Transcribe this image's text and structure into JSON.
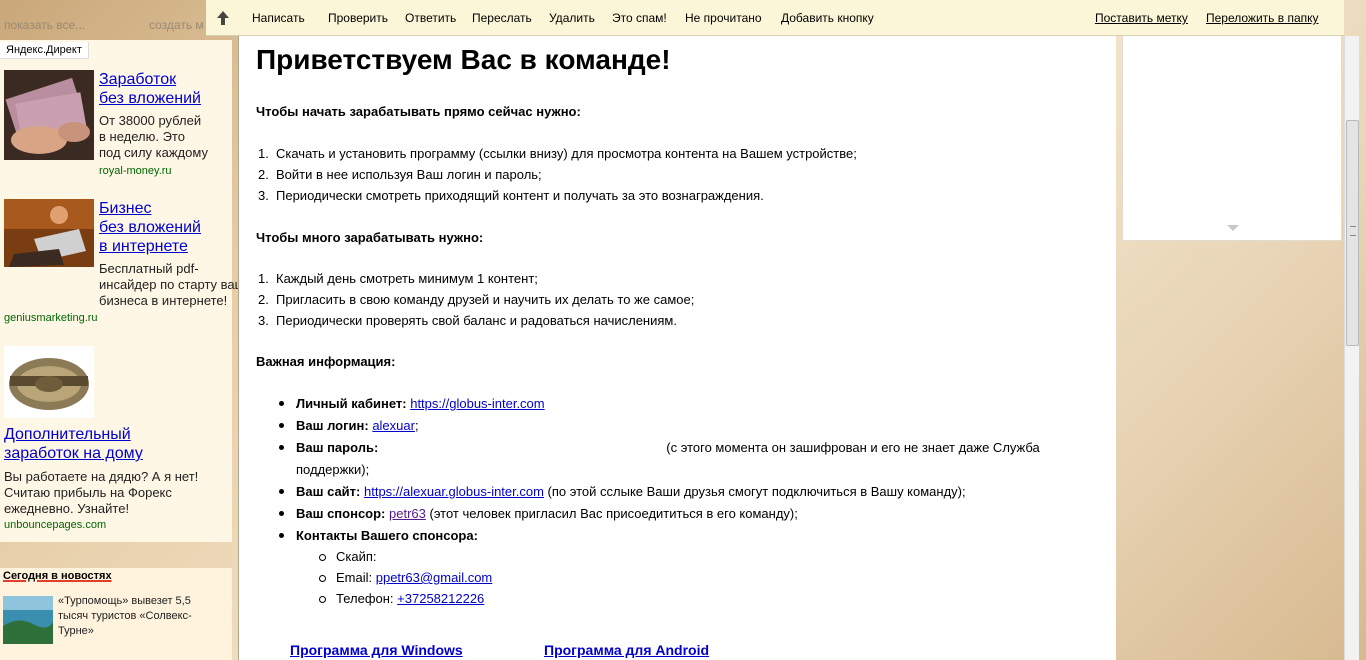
{
  "top_links": {
    "show_all": "показать все...",
    "create": "создать м"
  },
  "direct": {
    "tab_label": "Яндекс.Директ",
    "ads": [
      {
        "title": "Заработок\nбез вложений",
        "text": "От 38000 рублей\nв неделю. Это\nпод силу каждому",
        "domain": "royal-money.ru"
      },
      {
        "title": "Бизнес\nбез вложений\nв интернете",
        "text": "Бесплатный pdf-\nинсайдер по старту вашего\nбизнеса в интернете!",
        "domain": "geniusmarketing.ru"
      },
      {
        "title": "Дополнительный\nзаработок на дому",
        "text": "Вы работаете на дядю? А я нет!\nСчитаю прибыль на Форекс\nежедневно. Узнайте!",
        "domain": "unbouncepages.com"
      }
    ]
  },
  "news": {
    "heading": "Сегодня в новостях",
    "item": "«Турпомощь» вывезет 5,5 тысяч туристов «Солвекс-Турне»"
  },
  "toolbar": {
    "items": [
      "Написать",
      "Проверить",
      "Ответить",
      "Переслать",
      "Удалить",
      "Это спам!",
      "Не прочитано",
      "Добавить кнопку"
    ],
    "right": [
      "Поставить метку",
      "Переложить в папку"
    ]
  },
  "letter": {
    "title": "Приветствуем Вас в команде!",
    "section1": {
      "heading": "Чтобы начать зарабатывать прямо сейчас нужно:",
      "items": [
        "Скачать и установить программу (ссылки внизу) для просмотра контента на Вашем устройстве;",
        "Войти в нее используя Ваш логин и пароль;",
        "Периодически смотреть приходящий контент и получать за это вознаграждения."
      ]
    },
    "section2": {
      "heading": "Чтобы много зарабатывать нужно:",
      "items": [
        "Каждый день смотреть минимум 1 контент;",
        "Пригласить в свою команду друзей и научить их делать то же самое;",
        "Периодически проверять свой баланс и радоваться начислениям."
      ]
    },
    "section3": {
      "heading": "Важная информация:",
      "cabinet": {
        "label": "Личный кабинет:",
        "link": "https://globus-inter.com"
      },
      "login": {
        "label": "Ваш логин:",
        "link": "alexuar",
        "suffix": ";"
      },
      "password": {
        "label": "Ваш пароль:",
        "note": "(с этого момента он зашифрован и его не знает даже Служба",
        "note2": "поддержки);"
      },
      "site": {
        "label": "Ваш сайт:",
        "link": "https://alexuar.globus-inter.com",
        "suffix": " (по этой сслыке Ваши друзья смогут подключиться в Вашу команду);"
      },
      "sponsor": {
        "label": "Ваш спонсор:",
        "link": "petr63",
        "suffix": " (этот человек пригласил Вас присоедититься в его команду);"
      },
      "contacts": {
        "label": "Контакты Вашего спонсора:",
        "skype": "Скайп:",
        "email_label": "Email: ",
        "email": "ppetr63@gmail.com",
        "phone_label": "Телефон: ",
        "phone": "+37258212226"
      }
    },
    "downloads": {
      "windows": "Программа для Windows",
      "android": "Программа для Android"
    }
  }
}
